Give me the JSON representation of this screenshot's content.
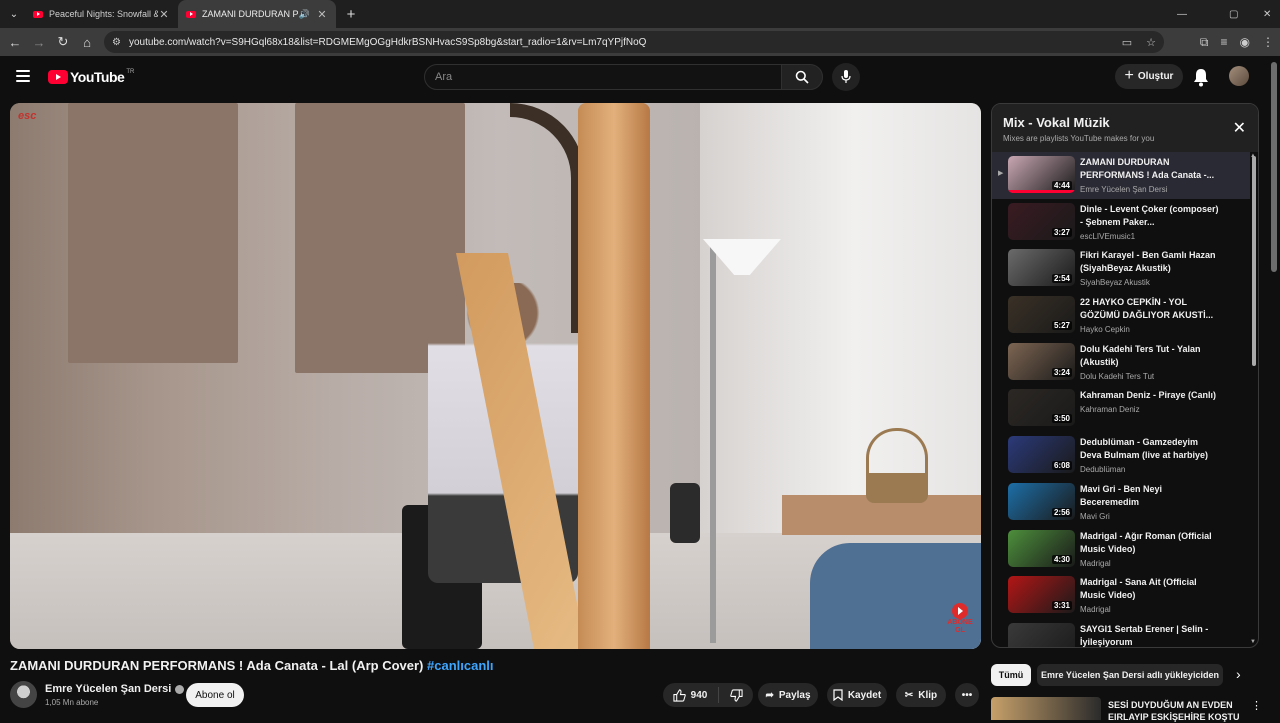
{
  "browser": {
    "tabs": [
      {
        "title": "Peaceful Nights: Snowfall & Cra",
        "active": false
      },
      {
        "title": "ZAMANI DURDURAN PERF",
        "active": true
      }
    ],
    "url": "youtube.com/watch?v=S9HGql68x18&list=RDGMEMgOGgHdkrBSNHvacS9Sp8bg&start_radio=1&rv=Lm7qYPjfNoQ"
  },
  "header": {
    "logo": "YouTube",
    "country": "TR",
    "search_placeholder": "Ara",
    "create_label": "Oluştur"
  },
  "video": {
    "overlay_logo": "esc",
    "subscribe_watermark": "ABONE OL",
    "title": "ZAMANI DURDURAN PERFORMANS ! Ada Canata - Lal (Arp Cover)",
    "hashtag": "#canlıcanlı",
    "channel": "Emre Yücelen Şan Dersi",
    "subscribers": "1,05 Mn abone",
    "subscribe_label": "Abone ol",
    "likes": "940",
    "share_label": "Paylaş",
    "save_label": "Kaydet",
    "clip_label": "Klip"
  },
  "playlist": {
    "title": "Mix - Vokal Müzik",
    "subtitle": "Mixes are playlists YouTube makes for you",
    "items": [
      {
        "title": "ZAMANI DURDURAN PERFORMANS ! Ada Canata -...",
        "channel": "Emre Yücelen Şan Dersi",
        "duration": "4:44",
        "current": true,
        "thumb": "#c9a7b3"
      },
      {
        "title": "Dinle - Levent Çoker (composer) - Şebnem Paker...",
        "channel": "escLIVEmusic1",
        "duration": "3:27",
        "current": false,
        "thumb": "#3a1b22"
      },
      {
        "title": "Fikri Karayel - Ben Gamlı Hazan (SiyahBeyaz Akustik)",
        "channel": "SiyahBeyaz Akustik",
        "duration": "2:54",
        "current": false,
        "thumb": "#6b6b6b"
      },
      {
        "title": "22 HAYKO CEPKİN - YOL GÖZÜMÜ DAĞLIYOR AKUSTİ...",
        "channel": "Hayko Cepkin",
        "duration": "5:27",
        "current": false,
        "thumb": "#3a3126"
      },
      {
        "title": "Dolu Kadehi Ters Tut - Yalan (Akustik)",
        "channel": "Dolu Kadehi Ters Tut",
        "duration": "3:24",
        "current": false,
        "thumb": "#7d6552"
      },
      {
        "title": "Kahraman Deniz - Piraye (Canlı)",
        "channel": "Kahraman Deniz",
        "duration": "3:50",
        "current": false,
        "thumb": "#2c2824"
      },
      {
        "title": "Dedublüman - Gamzedeyim Deva Bulmam (live at harbiye)",
        "channel": "Dedublüman",
        "duration": "6:08",
        "current": false,
        "thumb": "#2b3a7a"
      },
      {
        "title": "Mavi Gri - Ben Neyi Beceremedim",
        "channel": "Mavi Gri",
        "duration": "2:56",
        "current": false,
        "thumb": "#1d6fa8"
      },
      {
        "title": "Madrigal - Ağır Roman (Official Music Video)",
        "channel": "Madrigal",
        "duration": "4:30",
        "current": false,
        "thumb": "#4d8f3c"
      },
      {
        "title": "Madrigal - Sana Ait (Official Music Video)",
        "channel": "Madrigal",
        "duration": "3:31",
        "current": false,
        "thumb": "#b31616"
      },
      {
        "title": "SAYGI1 Sertab Erener | Selin - İyileşiyorum",
        "channel": "",
        "duration": "",
        "current": false,
        "thumb": "#3a3a3a"
      }
    ]
  },
  "chips": {
    "all": "Tümü",
    "other": "Emre Yücelen Şan Dersi adlı yükleyiciden"
  },
  "recommendation": {
    "title": "SESİ DUYDUĞUM AN EVDEN EIRLAYIP ESKİŞEHİRE KOŞTU"
  }
}
